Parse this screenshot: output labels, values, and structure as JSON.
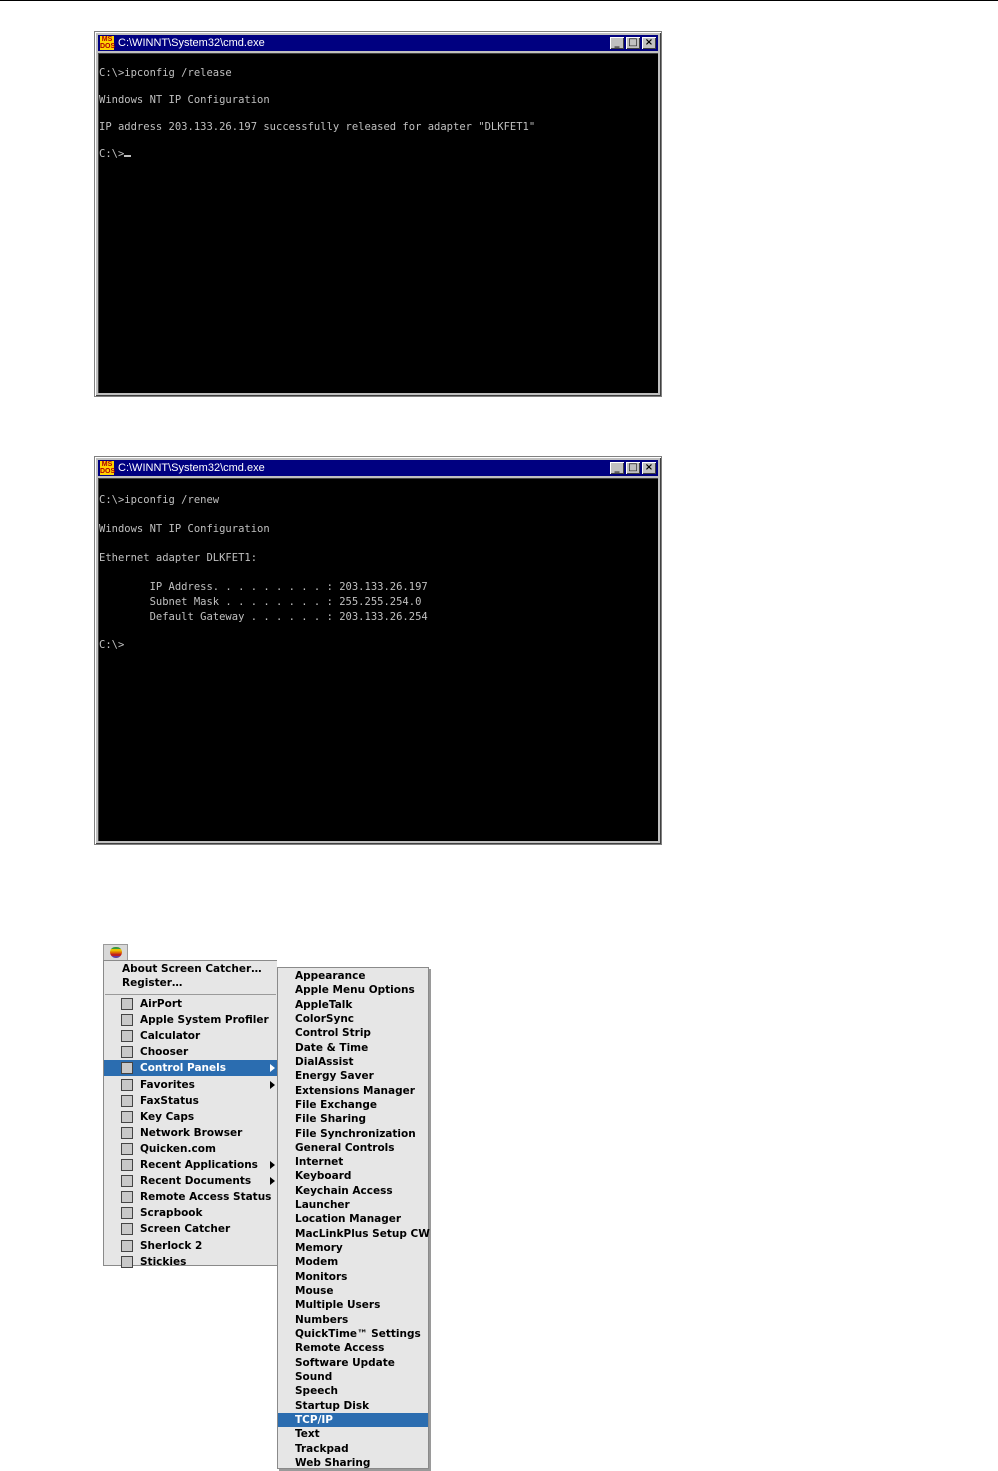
{
  "window1": {
    "title": "C:\\WINNT\\System32\\cmd.exe",
    "icon_label": "MS DOS",
    "lines": [
      "C:\\>ipconfig /release",
      "Windows NT IP Configuration",
      "IP address 203.133.26.197 successfully released for adapter \"DLKFET1\"",
      "C:\\>"
    ]
  },
  "window2": {
    "title": "C:\\WINNT\\System32\\cmd.exe",
    "icon_label": "MS DOS",
    "lines": [
      "C:\\>ipconfig /renew",
      "Windows NT IP Configuration",
      "Ethernet adapter DLKFET1:",
      "        IP Address. . . . . . . . . : 203.133.26.197",
      "        Subnet Mask . . . . . . . . : 255.255.254.0",
      "        Default Gateway . . . . . . : 203.133.26.254",
      "C:\\>"
    ]
  },
  "window_buttons": {
    "minimize": "_",
    "maximize": "□",
    "close": "×"
  },
  "apple_menu": {
    "header_items": [
      "About Screen Catcher…",
      "Register…"
    ],
    "items": [
      {
        "label": "AirPort",
        "icon": "airport-icon",
        "submenu": false
      },
      {
        "label": "Apple System Profiler",
        "icon": "profiler-icon",
        "submenu": false
      },
      {
        "label": "Calculator",
        "icon": "calculator-icon",
        "submenu": false
      },
      {
        "label": "Chooser",
        "icon": "chooser-icon",
        "submenu": false
      },
      {
        "label": "Control Panels",
        "icon": "control-panels-icon",
        "submenu": true,
        "selected": true
      },
      {
        "label": "Favorites",
        "icon": "favorites-icon",
        "submenu": true
      },
      {
        "label": "FaxStatus",
        "icon": "fax-icon",
        "submenu": false
      },
      {
        "label": "Key Caps",
        "icon": "keycaps-icon",
        "submenu": false
      },
      {
        "label": "Network Browser",
        "icon": "network-icon",
        "submenu": false
      },
      {
        "label": "Quicken.com",
        "icon": "quicken-icon",
        "submenu": false
      },
      {
        "label": "Recent Applications",
        "icon": "recent-apps-icon",
        "submenu": true
      },
      {
        "label": "Recent Documents",
        "icon": "recent-docs-icon",
        "submenu": true
      },
      {
        "label": "Remote Access Status",
        "icon": "remote-access-icon",
        "submenu": false
      },
      {
        "label": "Scrapbook",
        "icon": "scrapbook-icon",
        "submenu": false
      },
      {
        "label": "Screen Catcher",
        "icon": "camera-icon",
        "submenu": false
      },
      {
        "label": "Sherlock 2",
        "icon": "sherlock-icon",
        "submenu": false
      },
      {
        "label": "Stickies",
        "icon": "stickies-icon",
        "submenu": false
      }
    ]
  },
  "control_panels": {
    "selected": "TCP/IP",
    "items": [
      "Appearance",
      "Apple Menu Options",
      "AppleTalk",
      "ColorSync",
      "Control Strip",
      "Date & Time",
      "DialAssist",
      "Energy Saver",
      "Extensions Manager",
      "File Exchange",
      "File Sharing",
      "File Synchronization",
      "General Controls",
      "Internet",
      "Keyboard",
      "Keychain Access",
      "Launcher",
      "Location Manager",
      "MacLinkPlus Setup CW",
      "Memory",
      "Modem",
      "Monitors",
      "Mouse",
      "Multiple Users",
      "Numbers",
      "QuickTime™ Settings",
      "Remote Access",
      "Software Update",
      "Sound",
      "Speech",
      "Startup Disk",
      "TCP/IP",
      "Text",
      "Trackpad",
      "Web Sharing"
    ]
  },
  "colors": {
    "titlebar": "#000080",
    "console_bg": "#000000",
    "console_text": "#c0c0c0",
    "mac_highlight": "#2b6db0",
    "menu_bg": "#e6e6e6"
  }
}
